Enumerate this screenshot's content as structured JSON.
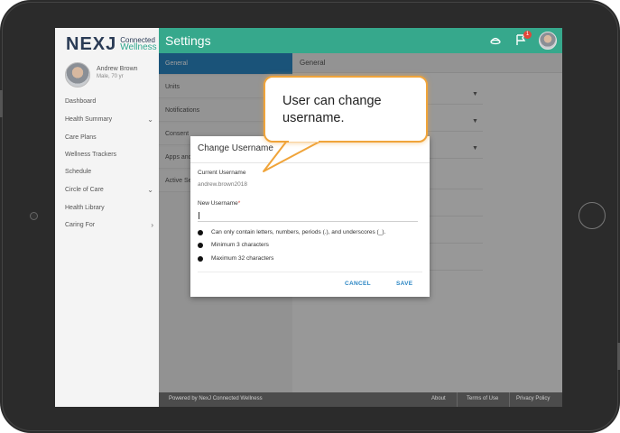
{
  "app": {
    "logo_mark": "NEXJ",
    "logo_line1": "Connected",
    "logo_line2": "Wellness"
  },
  "profile": {
    "name": "Andrew Brown",
    "details": "Male, 70 yr"
  },
  "sidebar": {
    "items": [
      {
        "label": "Dashboard",
        "chevron": ""
      },
      {
        "label": "Health Summary",
        "chevron": "⌄"
      },
      {
        "label": "Care Plans",
        "chevron": ""
      },
      {
        "label": "Wellness Trackers",
        "chevron": ""
      },
      {
        "label": "Schedule",
        "chevron": ""
      },
      {
        "label": "Circle of Care",
        "chevron": "⌄"
      },
      {
        "label": "Health Library",
        "chevron": ""
      },
      {
        "label": "Caring For",
        "chevron": "›"
      }
    ]
  },
  "header": {
    "title": "Settings",
    "notification_count": "1"
  },
  "settings": {
    "items": [
      {
        "label": "General"
      },
      {
        "label": "Units"
      },
      {
        "label": "Notifications"
      },
      {
        "label": "Consent"
      },
      {
        "label": "Apps and"
      },
      {
        "label": "Active Se"
      }
    ],
    "panel_title": "General"
  },
  "dialog": {
    "title": "Change Username",
    "current_label": "Current Username",
    "current_value": "andrew.brown2018",
    "new_label": "New Username",
    "required_mark": "*",
    "new_value": "",
    "rules": [
      "Can only contain letters, numbers, periods (.), and underscores (_).",
      "Minimum 3 characters",
      "Maximum 32 characters"
    ],
    "cancel_label": "CANCEL",
    "save_label": "SAVE"
  },
  "callout": {
    "text": "User can change username."
  },
  "footer": {
    "powered_by": "Powered by NexJ Connected Wellness",
    "links": [
      "About",
      "Terms of Use",
      "Privacy Policy"
    ]
  },
  "colors": {
    "header": "#36a88c",
    "active_item": "#2b86c4",
    "accent_button": "#2b86c4",
    "callout_border": "#f0a43a",
    "badge": "#e2473b"
  }
}
